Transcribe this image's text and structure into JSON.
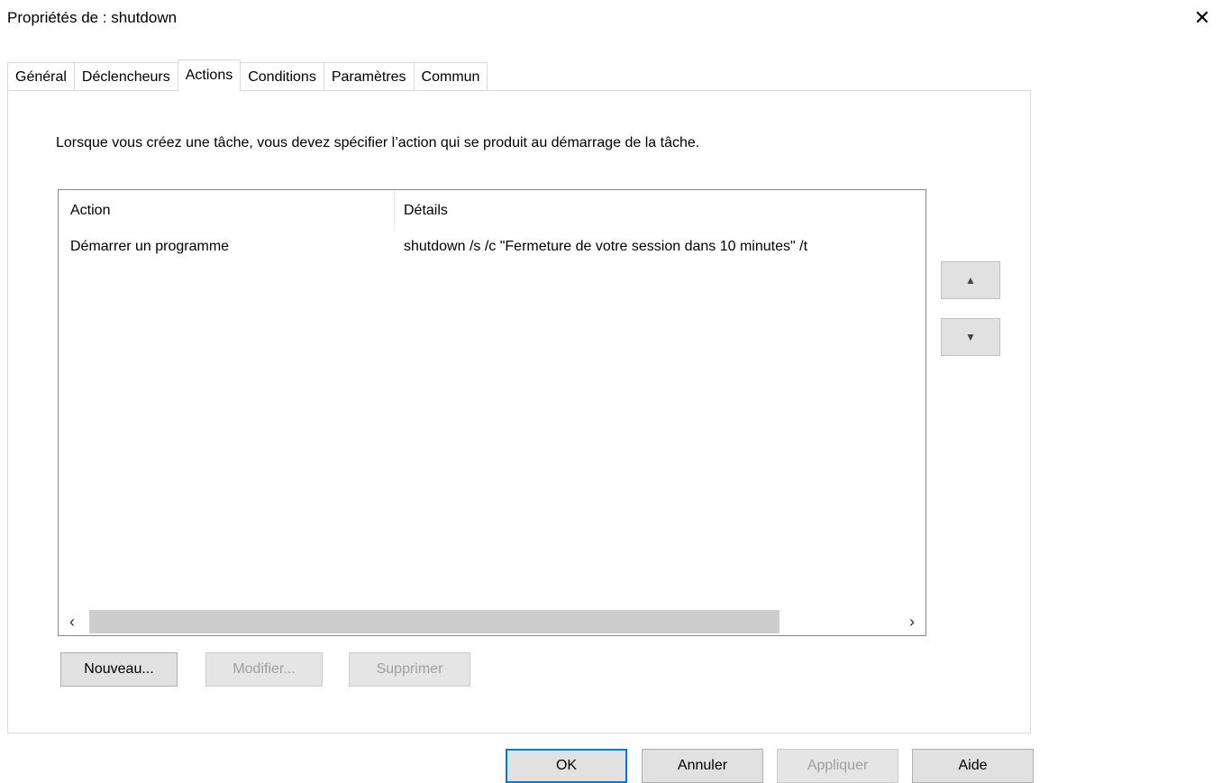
{
  "window": {
    "title": "Propriétés de : shutdown",
    "close_icon": "close-icon"
  },
  "tabs": [
    {
      "label": "Général"
    },
    {
      "label": "Déclencheurs"
    },
    {
      "label": "Actions",
      "active": true
    },
    {
      "label": "Conditions"
    },
    {
      "label": "Paramètres"
    },
    {
      "label": "Commun"
    }
  ],
  "panel": {
    "description": "Lorsque vous créez une tâche, vous devez spécifier l’action qui se produit au démarrage de la tâche."
  },
  "actions_list": {
    "columns": [
      "Action",
      "Détails"
    ],
    "rows": [
      {
        "action": "Démarrer un programme",
        "details": "shutdown /s /c \"Fermeture de votre session dans 10 minutes\" /t"
      }
    ],
    "scroll_left_icon": "‹",
    "scroll_right_icon": "›"
  },
  "side_buttons": {
    "up_icon": "▲",
    "down_icon": "▼"
  },
  "action_buttons": {
    "new": "Nouveau...",
    "edit": "Modifier...",
    "delete": "Supprimer"
  },
  "dialog_buttons": {
    "ok": "OK",
    "cancel": "Annuler",
    "apply": "Appliquer",
    "help": "Aide"
  },
  "colors": {
    "accent": "#0078d7",
    "button_bg": "#e1e1e1",
    "disabled_text": "#a0a0a0"
  }
}
